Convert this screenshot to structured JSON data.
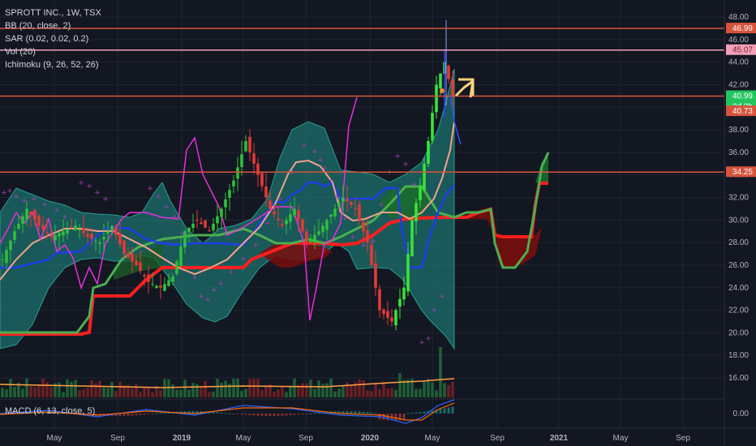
{
  "legend": {
    "title": "SPROTT INC., 1W, TSX",
    "bb": "BB (20, close, 2)",
    "sar": "SAR (0.02, 0.02, 0.2)",
    "vol": "Vol (20)",
    "ichimoku": "Ichimoku (9, 26, 52, 26)"
  },
  "macd_label": "MACD (6, 13, close, 5)",
  "colors": {
    "background": "#131722",
    "up": "#26a69a",
    "bright_up": "#39e23a",
    "down": "#d32f2f",
    "bb_fill": "#1f8f86",
    "bb_line": "#2a9d8f",
    "sar": "#a83fb5",
    "hline": "#d6543c",
    "hline_pink": "#f2a1b8",
    "kijun": "#1e3ee8",
    "chikou": "#e82fdb",
    "senkou_a": "#4caf50",
    "senkou_b": "#ff1e1e",
    "basis": "#f4a28c"
  },
  "chart_data": {
    "type": "line",
    "x_axis_ticks": [
      "May",
      "Sep",
      "2019",
      "May",
      "Sep",
      "2020",
      "May",
      "Sep",
      "2021",
      "May",
      "Sep"
    ],
    "y_axis_ticks": [
      "48.00",
      "46.00",
      "44.00",
      "42.00",
      "40.00",
      "38.00",
      "36.00",
      "34.00",
      "32.00",
      "30.00",
      "28.00",
      "26.00",
      "24.00",
      "22.00",
      "20.00",
      "18.00",
      "16.00"
    ],
    "ylim": [
      15,
      49
    ],
    "macd_tick": "0.00",
    "price_labels": {
      "top_red": "46.99",
      "pink": "45.07",
      "current": "40.99",
      "countdown": "2d 3h",
      "lower": "40.73",
      "support": "34.25"
    },
    "horizontal_levels": [
      46.99,
      45.07,
      40.99,
      34.25
    ],
    "series": [
      {
        "x": [
          0,
          3,
          6,
          9,
          12,
          15,
          18,
          21,
          24,
          27,
          30,
          33,
          36,
          39,
          42,
          45,
          48,
          51,
          54,
          57,
          60,
          63,
          66,
          69,
          72,
          75,
          78,
          81,
          84,
          87,
          90,
          93,
          96,
          99,
          101,
          103,
          105,
          107,
          109,
          111
        ],
        "values": [
          26.5,
          29,
          31,
          29.5,
          28.5,
          29,
          29.5,
          28.5,
          28,
          29.5,
          27,
          26,
          24.5,
          24,
          25,
          29,
          30,
          29,
          31,
          33.5,
          37,
          34,
          31,
          29.5,
          31,
          28,
          29,
          30.5,
          32,
          31,
          28,
          22,
          21,
          24,
          30,
          33,
          37,
          42,
          44,
          40.99
        ]
      }
    ],
    "x_time_labels_positions_note": ""
  }
}
